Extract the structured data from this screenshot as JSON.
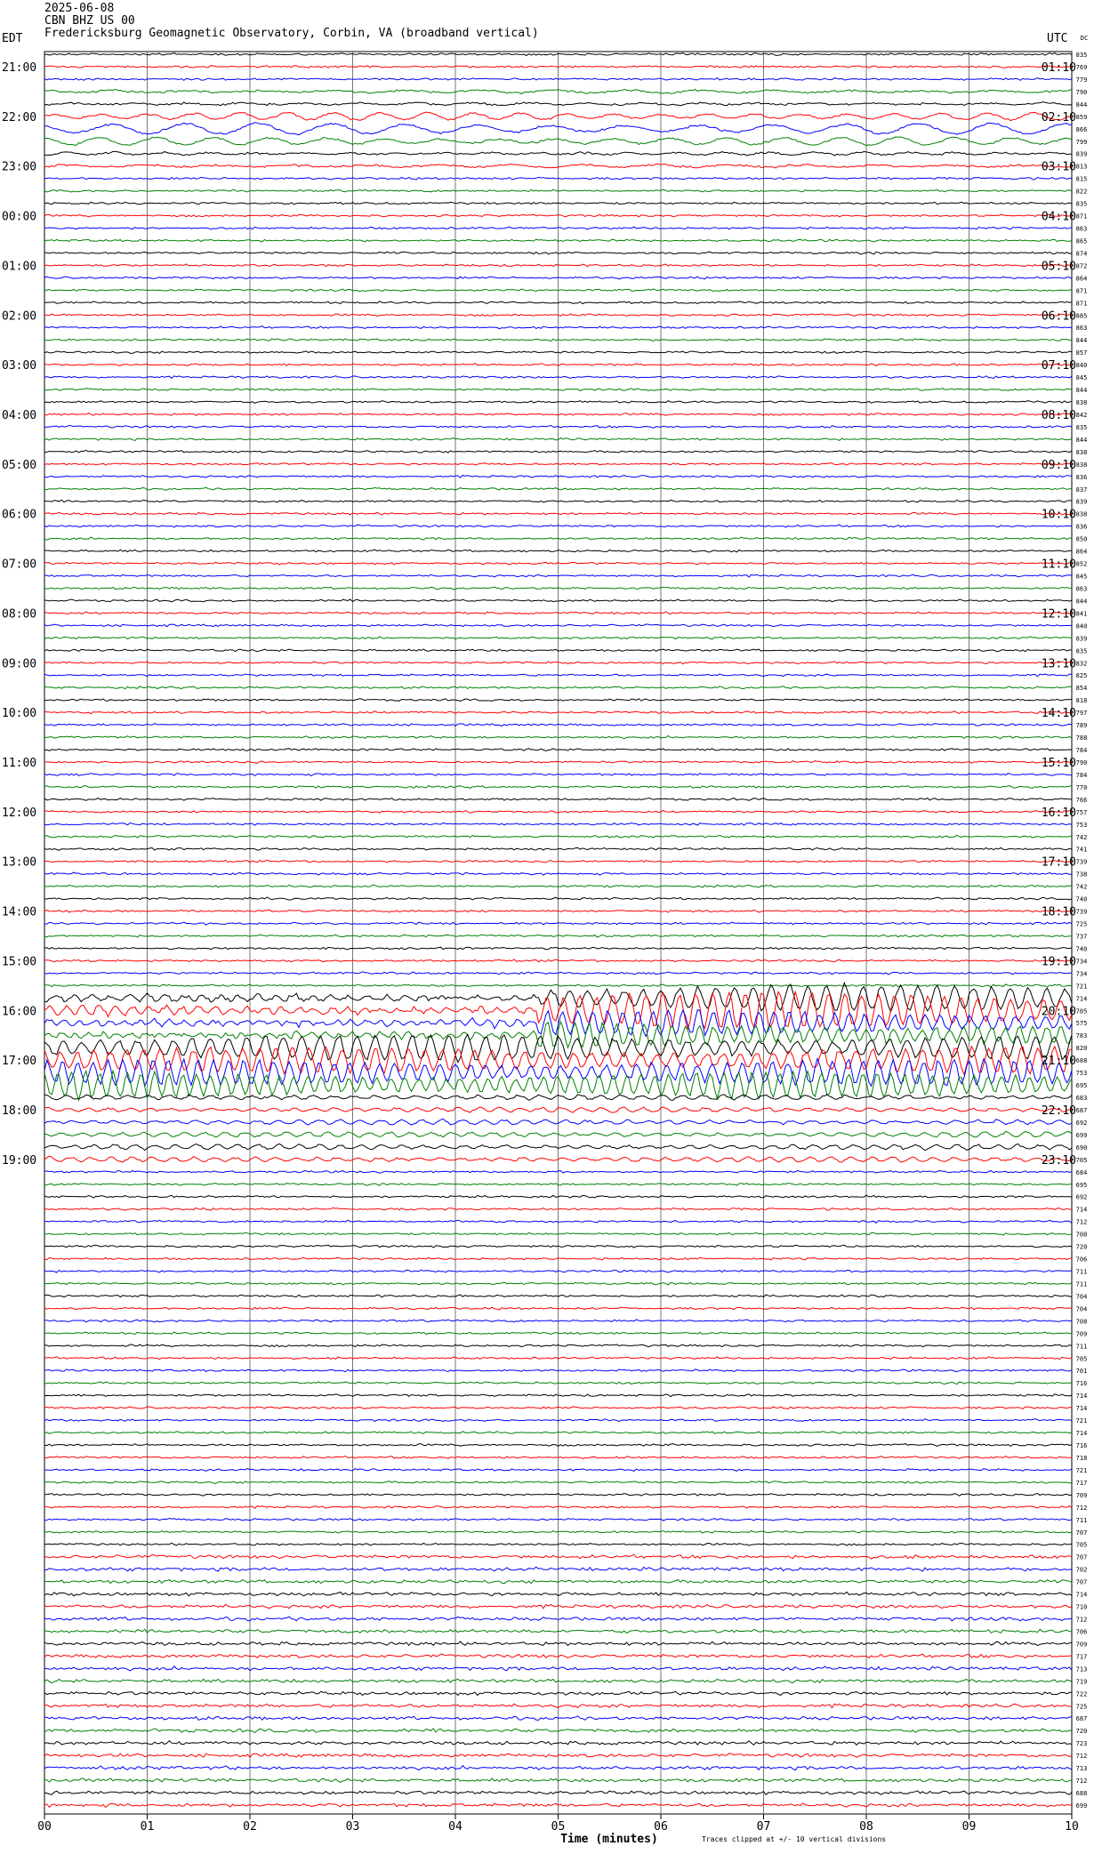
{
  "header": {
    "date": "2025-06-08",
    "station": "CBN BHZ US 00",
    "location": "Fredericksburg Geomagnetic Observatory, Corbin, VA (broadband vertical)"
  },
  "chart_data": {
    "type": "line",
    "left_timezone": "EDT",
    "right_timezone": "UTC",
    "corner_mark": "DC",
    "left_time_labels": [
      "21:00",
      "22:00",
      "23:00",
      "00:00",
      "01:00",
      "02:00",
      "03:00",
      "04:00",
      "05:00",
      "06:00",
      "07:00",
      "08:00",
      "09:00",
      "10:00",
      "11:00",
      "12:00",
      "13:00",
      "14:00",
      "15:00",
      "16:00",
      "17:00",
      "18:00",
      "19:00"
    ],
    "right_time_labels": [
      "01:10",
      "02:10",
      "03:10",
      "04:10",
      "05:10",
      "06:10",
      "07:10",
      "08:10",
      "09:10",
      "10:10",
      "11:10",
      "12:10",
      "13:10",
      "14:10",
      "15:10",
      "16:10",
      "17:10",
      "18:10",
      "19:10",
      "20:10",
      "21:10",
      "22:10",
      "23:10"
    ],
    "xlabel": "Time (minutes)",
    "x_ticks": [
      "00",
      "01",
      "02",
      "03",
      "04",
      "05",
      "06",
      "07",
      "08",
      "09",
      "10"
    ],
    "xlim": [
      0,
      10
    ],
    "note": "Traces clipped at +/- 10 vertical divisions",
    "trace_colors": [
      "#000000",
      "#ff0000",
      "#0000ff",
      "#008000"
    ],
    "trace_dc_values": [
      "835",
      "769",
      "779",
      "790",
      "844",
      "859",
      "866",
      "799",
      "839",
      "813",
      "815",
      "822",
      "835",
      "871",
      "863",
      "865",
      "874",
      "872",
      "864",
      "871",
      "871",
      "885",
      "863",
      "844",
      "857",
      "840",
      "845",
      "844",
      "838",
      "842",
      "835",
      "844",
      "838",
      "838",
      "836",
      "837",
      "839",
      "838",
      "836",
      "850",
      "864",
      "852",
      "845",
      "863",
      "844",
      "841",
      "840",
      "839",
      "835",
      "832",
      "825",
      "854",
      "818",
      "797",
      "789",
      "788",
      "784",
      "790",
      "784",
      "770",
      "766",
      "757",
      "753",
      "742",
      "741",
      "739",
      "738",
      "742",
      "740",
      "739",
      "725",
      "737",
      "740",
      "734",
      "734",
      "721",
      "714",
      "705",
      "575",
      "783",
      "820",
      "688",
      "753",
      "695",
      "683",
      "687",
      "692",
      "699",
      "690",
      "705",
      "684",
      "695",
      "692",
      "714",
      "712",
      "708",
      "720",
      "706",
      "711",
      "711",
      "704",
      "704",
      "708",
      "709",
      "711",
      "705",
      "701",
      "716",
      "714",
      "714",
      "721",
      "714",
      "716",
      "718",
      "721",
      "717",
      "709",
      "712",
      "711",
      "707",
      "705",
      "707",
      "702",
      "707",
      "714",
      "710",
      "712",
      "706",
      "709",
      "717",
      "713",
      "719",
      "722",
      "725",
      "687",
      "720",
      "723",
      "712",
      "713",
      "712",
      "688",
      "699"
    ],
    "event_rows": [
      76,
      77,
      78,
      79,
      80,
      81,
      82,
      83
    ]
  }
}
